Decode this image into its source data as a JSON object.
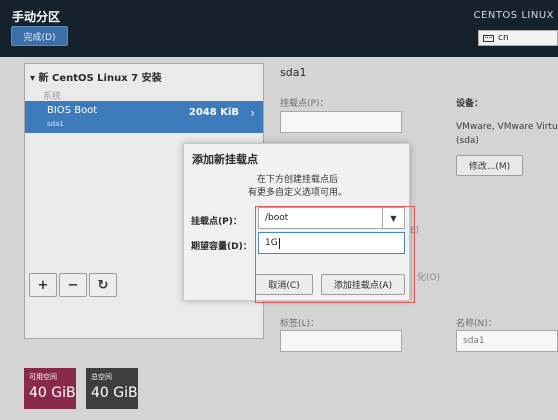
{
  "header": {
    "title": "手动分区",
    "done_label": "完成(D)",
    "os_name": "CENTOS LINUX",
    "keyboard_layout": "cn"
  },
  "left": {
    "install_title": "▾ 新 CentOS Linux 7 安装",
    "group_label": "系统",
    "partition": {
      "name": "BIOS Boot",
      "device": "sda1",
      "size": "2048 KiB"
    },
    "buttons": {
      "add": "+",
      "remove": "−",
      "refresh": "↻"
    },
    "available_space": {
      "label": "可用空间",
      "value": "40 GiB",
      "color": "#8a2a4a"
    },
    "total_space": {
      "label": "总空间",
      "value": "40 GiB",
      "color": "#3e3e3e"
    }
  },
  "right": {
    "title": "sda1",
    "mount_label": "挂载点(P)：",
    "device_label": "设备：",
    "device_text": "VMware, VMware Virtu",
    "device_sub": "(sda)",
    "modify_label": "修改...(M)",
    "frag_e": "E)",
    "frag_c": "化(O)",
    "tag_label": "标签(L)：",
    "name_label": "名称(N)：",
    "name_value": "sda1"
  },
  "dialog": {
    "title": "添加新挂载点",
    "desc1": "在下方创建挂载点后",
    "desc2": "有更多自定义选项可用。",
    "mount_label": "挂载点(P)：",
    "mount_value": "/boot",
    "capacity_label": "期望容量(D)：",
    "capacity_value": "1G",
    "cancel_label": "取消(C)",
    "add_label": "添加挂载点(A)"
  }
}
